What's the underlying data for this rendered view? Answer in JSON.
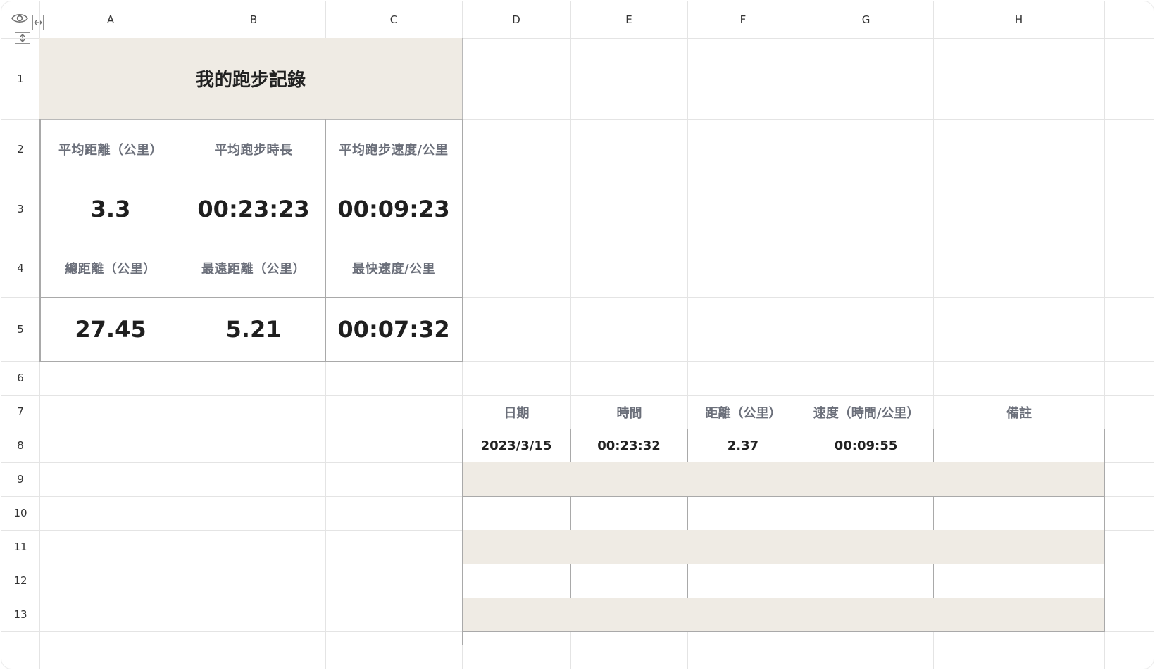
{
  "columns": [
    "A",
    "B",
    "C",
    "D",
    "E",
    "F",
    "G",
    "H"
  ],
  "rows": [
    "1",
    "2",
    "3",
    "4",
    "5",
    "6",
    "7",
    "8",
    "9",
    "10",
    "11",
    "12",
    "13"
  ],
  "summary": {
    "title": "我的跑步記錄",
    "labels1": [
      "平均距離（公里）",
      "平均跑步時長",
      "平均跑步速度/公里"
    ],
    "values1": [
      "3.3",
      "00:23:23",
      "00:09:23"
    ],
    "labels2": [
      "總距離（公里）",
      "最遠距離（公里）",
      "最快速度/公里"
    ],
    "values2": [
      "27.45",
      "5.21",
      "00:07:32"
    ]
  },
  "log_table": {
    "headers": [
      "日期",
      "時間",
      "距離（公里）",
      "速度（時間/公里）",
      "備註"
    ],
    "rows": [
      [
        "2023/3/15",
        "00:23:32",
        "2.37",
        "00:09:55",
        ""
      ]
    ]
  },
  "colors": {
    "shade": "#efebe4",
    "label_text": "#6b6f7a",
    "grid": "#e4e4e4",
    "border": "#a9a9a9"
  },
  "icons": [
    "eye-icon",
    "collapse-columns-icon",
    "collapse-rows-icon"
  ]
}
